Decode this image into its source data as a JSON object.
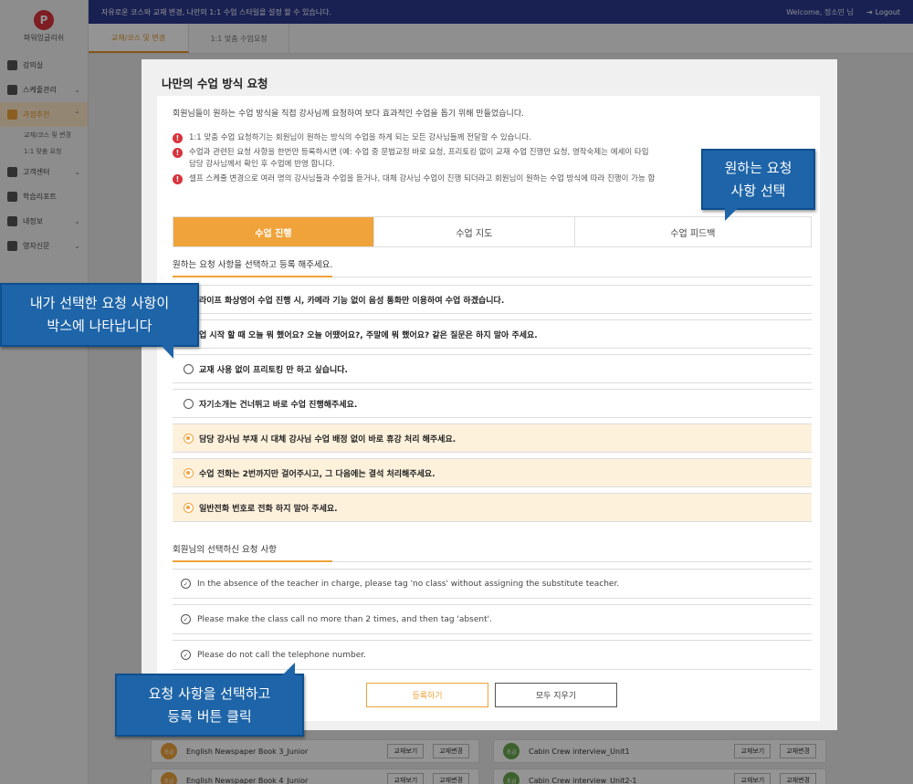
{
  "app": {
    "logo_letter": "P",
    "logo_text": "파워잉글리쉬",
    "notice": "자유로운 코스와 교재 변경, 나만의 1:1 수업 스타일을 설정 할 수 있습니다.",
    "welcome": "Welcome, 정소민 님",
    "logout": "Logout"
  },
  "sidebar": {
    "items": [
      {
        "label": "강의실",
        "icon": "classroom-icon",
        "chevron": ""
      },
      {
        "label": "스케줄관리",
        "icon": "schedule-icon",
        "chevron": "⌄"
      },
      {
        "label": "과정추천",
        "icon": "puzzle-icon",
        "chevron": "⌃"
      },
      {
        "label": "고객센터",
        "icon": "support-icon",
        "chevron": "⌄"
      },
      {
        "label": "학습리포트",
        "icon": "report-icon",
        "chevron": ""
      },
      {
        "label": "내정보",
        "icon": "user-icon",
        "chevron": "⌄"
      },
      {
        "label": "영자신문",
        "icon": "newspaper-icon",
        "chevron": "⌄"
      }
    ],
    "subitems": [
      "교재/코스 및 변경",
      "1:1 맞춤 요청"
    ]
  },
  "page_tabs": [
    "교재/코스 및 변경",
    "1:1 맞춤 수업요청"
  ],
  "background_rows": [
    {
      "badge": "초급",
      "name": "English Newspaper Book 3_Junior",
      "btn1": "교재보기",
      "btn2": "교재변경"
    },
    {
      "badge": "초급",
      "name": "Cabin Crew interview_Unit1",
      "btn1": "교재보기",
      "btn2": "교재변경"
    },
    {
      "badge": "초급",
      "name": "English Newspaper Book 4_Junior",
      "btn1": "교재보기",
      "btn2": "교재변경"
    },
    {
      "badge": "초급",
      "name": "Cabin Crew interview_Unit2-1",
      "btn1": "교재보기",
      "btn2": "교재변경"
    }
  ],
  "modal": {
    "title": "나만의 수업 방식 요청",
    "intro": "회원님들이 원하는 수업 방식을 직접 강사님께 요청하여 보다 효과적인 수업을 돕기 위해 만들었습니다.",
    "notes": [
      "1:1 맞춤 수업 요청하기는 회원님이 원하는 방식의 수업을 하게 되는 모든 강사님들께 전달할 수 있습니다.",
      "수업과 관련된 요청 사항을 한번만 등록하시면 (예: 수업 중 문법교정 바로 요청, 프리토킹 없이 교재 수업 진행만 요청, 영작숙제는 에세이 타입",
      "담당 강사님께서 확인 후 수업에 반영 합니다.",
      "셀프 스케줄 변경으로 여러 명의 강사님들과 수업을 듣거나, 대체 강사님 수업이 진행 되더라고 회원님이 원하는 수업 방식에 따라 진행이 가능 합"
    ],
    "tabs": [
      "수업 진행",
      "수업 지도",
      "수업 피드백"
    ],
    "options_heading": "원하는 요청 사항을 선택하고 등록 해주세요.",
    "options": [
      {
        "text": "라이프 화상영어 수업 진행 시, 카메라 기능 없이 음성 통화만 이용하여 수업 하겠습니다.",
        "selected": false
      },
      {
        "text": "업 시작 할 때 오늘 뭐 했어요? 오늘 어땠어요?, 주말에 뭐 했어요? 같은 질문은 하지 말아 주세요.",
        "selected": false
      },
      {
        "text": "교재 사용 없이 프리토킹 만 하고 싶습니다.",
        "selected": false
      },
      {
        "text": "자기소개는 건너뛰고 바로 수업 진행해주세요.",
        "selected": false
      },
      {
        "text": "담당 강사님 부재 시 대체 강사님 수업 배정 없이 바로 휴강 처리 해주세요.",
        "selected": true
      },
      {
        "text": "수업 전화는 2번까지만 걸어주시고, 그 다음에는 결석 처리해주세요.",
        "selected": true
      },
      {
        "text": "일반전화 번호로 전화 하지 말아 주세요.",
        "selected": true
      }
    ],
    "selected_heading": "회원님의 선택하신 요청 사항",
    "selected_items": [
      "In the absence of the teacher in charge, please tag 'no class' without assigning the substitute teacher.",
      "Please make the class call no more than 2 times, and then tag 'absent'.",
      "Please do not call the telephone number."
    ],
    "register_button": "등록하기",
    "clear_button": "모두 지우기"
  },
  "callouts": {
    "tabs_hint": [
      "원하는 요청",
      "사항 선택"
    ],
    "box_hint": [
      "내가 선택한 요청 사항이",
      "박스에 나타납니다"
    ],
    "register_hint": [
      "요청 사항을 선택하고",
      "등록 버튼 클릭"
    ]
  },
  "colors": {
    "accent": "#f0a33a",
    "topbar": "#2b3990",
    "alert": "#d9323b",
    "callout": "#1e64a8"
  }
}
